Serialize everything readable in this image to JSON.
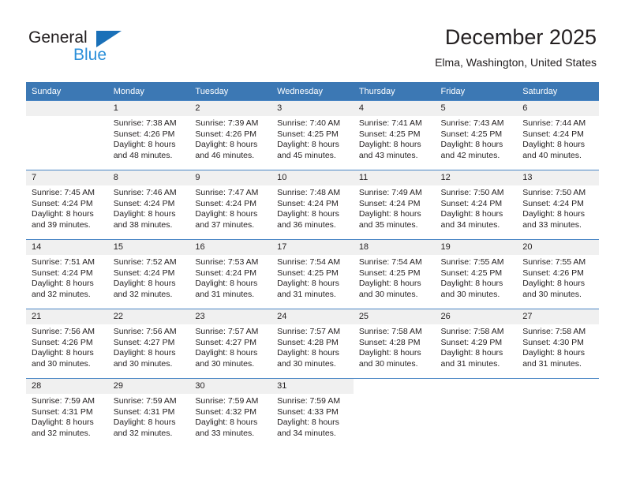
{
  "brand": {
    "name_part1": "General",
    "name_part2": "Blue",
    "logo_icon": "triangle-logo-icon",
    "accent_color": "#1a70b8",
    "text_color": "#2b8fd9"
  },
  "header": {
    "title": "December 2025",
    "subtitle": "Elma, Washington, United States"
  },
  "calendar": {
    "header_bg": "#3c78b4",
    "header_text_color": "#ffffff",
    "daynum_bg": "#f0f0f0",
    "row_border_color": "#4a86c5",
    "weekdays": [
      "Sunday",
      "Monday",
      "Tuesday",
      "Wednesday",
      "Thursday",
      "Friday",
      "Saturday"
    ],
    "weeks": [
      [
        {
          "day": "",
          "sunrise": "",
          "sunset": "",
          "daylight_line1": "",
          "daylight_line2": ""
        },
        {
          "day": "1",
          "sunrise": "Sunrise: 7:38 AM",
          "sunset": "Sunset: 4:26 PM",
          "daylight_line1": "Daylight: 8 hours",
          "daylight_line2": "and 48 minutes."
        },
        {
          "day": "2",
          "sunrise": "Sunrise: 7:39 AM",
          "sunset": "Sunset: 4:26 PM",
          "daylight_line1": "Daylight: 8 hours",
          "daylight_line2": "and 46 minutes."
        },
        {
          "day": "3",
          "sunrise": "Sunrise: 7:40 AM",
          "sunset": "Sunset: 4:25 PM",
          "daylight_line1": "Daylight: 8 hours",
          "daylight_line2": "and 45 minutes."
        },
        {
          "day": "4",
          "sunrise": "Sunrise: 7:41 AM",
          "sunset": "Sunset: 4:25 PM",
          "daylight_line1": "Daylight: 8 hours",
          "daylight_line2": "and 43 minutes."
        },
        {
          "day": "5",
          "sunrise": "Sunrise: 7:43 AM",
          "sunset": "Sunset: 4:25 PM",
          "daylight_line1": "Daylight: 8 hours",
          "daylight_line2": "and 42 minutes."
        },
        {
          "day": "6",
          "sunrise": "Sunrise: 7:44 AM",
          "sunset": "Sunset: 4:24 PM",
          "daylight_line1": "Daylight: 8 hours",
          "daylight_line2": "and 40 minutes."
        }
      ],
      [
        {
          "day": "7",
          "sunrise": "Sunrise: 7:45 AM",
          "sunset": "Sunset: 4:24 PM",
          "daylight_line1": "Daylight: 8 hours",
          "daylight_line2": "and 39 minutes."
        },
        {
          "day": "8",
          "sunrise": "Sunrise: 7:46 AM",
          "sunset": "Sunset: 4:24 PM",
          "daylight_line1": "Daylight: 8 hours",
          "daylight_line2": "and 38 minutes."
        },
        {
          "day": "9",
          "sunrise": "Sunrise: 7:47 AM",
          "sunset": "Sunset: 4:24 PM",
          "daylight_line1": "Daylight: 8 hours",
          "daylight_line2": "and 37 minutes."
        },
        {
          "day": "10",
          "sunrise": "Sunrise: 7:48 AM",
          "sunset": "Sunset: 4:24 PM",
          "daylight_line1": "Daylight: 8 hours",
          "daylight_line2": "and 36 minutes."
        },
        {
          "day": "11",
          "sunrise": "Sunrise: 7:49 AM",
          "sunset": "Sunset: 4:24 PM",
          "daylight_line1": "Daylight: 8 hours",
          "daylight_line2": "and 35 minutes."
        },
        {
          "day": "12",
          "sunrise": "Sunrise: 7:50 AM",
          "sunset": "Sunset: 4:24 PM",
          "daylight_line1": "Daylight: 8 hours",
          "daylight_line2": "and 34 minutes."
        },
        {
          "day": "13",
          "sunrise": "Sunrise: 7:50 AM",
          "sunset": "Sunset: 4:24 PM",
          "daylight_line1": "Daylight: 8 hours",
          "daylight_line2": "and 33 minutes."
        }
      ],
      [
        {
          "day": "14",
          "sunrise": "Sunrise: 7:51 AM",
          "sunset": "Sunset: 4:24 PM",
          "daylight_line1": "Daylight: 8 hours",
          "daylight_line2": "and 32 minutes."
        },
        {
          "day": "15",
          "sunrise": "Sunrise: 7:52 AM",
          "sunset": "Sunset: 4:24 PM",
          "daylight_line1": "Daylight: 8 hours",
          "daylight_line2": "and 32 minutes."
        },
        {
          "day": "16",
          "sunrise": "Sunrise: 7:53 AM",
          "sunset": "Sunset: 4:24 PM",
          "daylight_line1": "Daylight: 8 hours",
          "daylight_line2": "and 31 minutes."
        },
        {
          "day": "17",
          "sunrise": "Sunrise: 7:54 AM",
          "sunset": "Sunset: 4:25 PM",
          "daylight_line1": "Daylight: 8 hours",
          "daylight_line2": "and 31 minutes."
        },
        {
          "day": "18",
          "sunrise": "Sunrise: 7:54 AM",
          "sunset": "Sunset: 4:25 PM",
          "daylight_line1": "Daylight: 8 hours",
          "daylight_line2": "and 30 minutes."
        },
        {
          "day": "19",
          "sunrise": "Sunrise: 7:55 AM",
          "sunset": "Sunset: 4:25 PM",
          "daylight_line1": "Daylight: 8 hours",
          "daylight_line2": "and 30 minutes."
        },
        {
          "day": "20",
          "sunrise": "Sunrise: 7:55 AM",
          "sunset": "Sunset: 4:26 PM",
          "daylight_line1": "Daylight: 8 hours",
          "daylight_line2": "and 30 minutes."
        }
      ],
      [
        {
          "day": "21",
          "sunrise": "Sunrise: 7:56 AM",
          "sunset": "Sunset: 4:26 PM",
          "daylight_line1": "Daylight: 8 hours",
          "daylight_line2": "and 30 minutes."
        },
        {
          "day": "22",
          "sunrise": "Sunrise: 7:56 AM",
          "sunset": "Sunset: 4:27 PM",
          "daylight_line1": "Daylight: 8 hours",
          "daylight_line2": "and 30 minutes."
        },
        {
          "day": "23",
          "sunrise": "Sunrise: 7:57 AM",
          "sunset": "Sunset: 4:27 PM",
          "daylight_line1": "Daylight: 8 hours",
          "daylight_line2": "and 30 minutes."
        },
        {
          "day": "24",
          "sunrise": "Sunrise: 7:57 AM",
          "sunset": "Sunset: 4:28 PM",
          "daylight_line1": "Daylight: 8 hours",
          "daylight_line2": "and 30 minutes."
        },
        {
          "day": "25",
          "sunrise": "Sunrise: 7:58 AM",
          "sunset": "Sunset: 4:28 PM",
          "daylight_line1": "Daylight: 8 hours",
          "daylight_line2": "and 30 minutes."
        },
        {
          "day": "26",
          "sunrise": "Sunrise: 7:58 AM",
          "sunset": "Sunset: 4:29 PM",
          "daylight_line1": "Daylight: 8 hours",
          "daylight_line2": "and 31 minutes."
        },
        {
          "day": "27",
          "sunrise": "Sunrise: 7:58 AM",
          "sunset": "Sunset: 4:30 PM",
          "daylight_line1": "Daylight: 8 hours",
          "daylight_line2": "and 31 minutes."
        }
      ],
      [
        {
          "day": "28",
          "sunrise": "Sunrise: 7:59 AM",
          "sunset": "Sunset: 4:31 PM",
          "daylight_line1": "Daylight: 8 hours",
          "daylight_line2": "and 32 minutes."
        },
        {
          "day": "29",
          "sunrise": "Sunrise: 7:59 AM",
          "sunset": "Sunset: 4:31 PM",
          "daylight_line1": "Daylight: 8 hours",
          "daylight_line2": "and 32 minutes."
        },
        {
          "day": "30",
          "sunrise": "Sunrise: 7:59 AM",
          "sunset": "Sunset: 4:32 PM",
          "daylight_line1": "Daylight: 8 hours",
          "daylight_line2": "and 33 minutes."
        },
        {
          "day": "31",
          "sunrise": "Sunrise: 7:59 AM",
          "sunset": "Sunset: 4:33 PM",
          "daylight_line1": "Daylight: 8 hours",
          "daylight_line2": "and 34 minutes."
        },
        {
          "day": "",
          "sunrise": "",
          "sunset": "",
          "daylight_line1": "",
          "daylight_line2": ""
        },
        {
          "day": "",
          "sunrise": "",
          "sunset": "",
          "daylight_line1": "",
          "daylight_line2": ""
        },
        {
          "day": "",
          "sunrise": "",
          "sunset": "",
          "daylight_line1": "",
          "daylight_line2": ""
        }
      ]
    ]
  }
}
